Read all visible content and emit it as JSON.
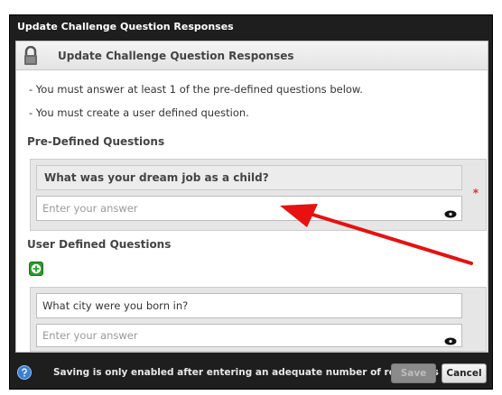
{
  "window": {
    "title": "Update Challenge Question Responses"
  },
  "header": {
    "title": "Update Challenge Question Responses"
  },
  "notes": [
    "- You must answer at least 1 of the pre-defined questions below.",
    "- You must create a user defined question."
  ],
  "predefined": {
    "section_title": "Pre-Defined Questions",
    "question": "What was your dream job as a child?",
    "answer_placeholder": "Enter your answer",
    "required_marker": "*"
  },
  "userdefined": {
    "section_title": "User Defined Questions",
    "question_value": "What city were you born in?",
    "answer_placeholder": "Enter your answer"
  },
  "footer": {
    "message": "Saving is only enabled after entering an adequate number of responses",
    "save_label": "Save",
    "cancel_label": "Cancel"
  },
  "colors": {
    "titlebar": "#1e1e1e",
    "required": "#e03030",
    "add": "#2c9a2c",
    "annotation_arrow": "#e81010"
  },
  "icons": [
    "lock-icon",
    "eye-icon",
    "add-icon",
    "help-icon",
    "arrow-annotation"
  ]
}
